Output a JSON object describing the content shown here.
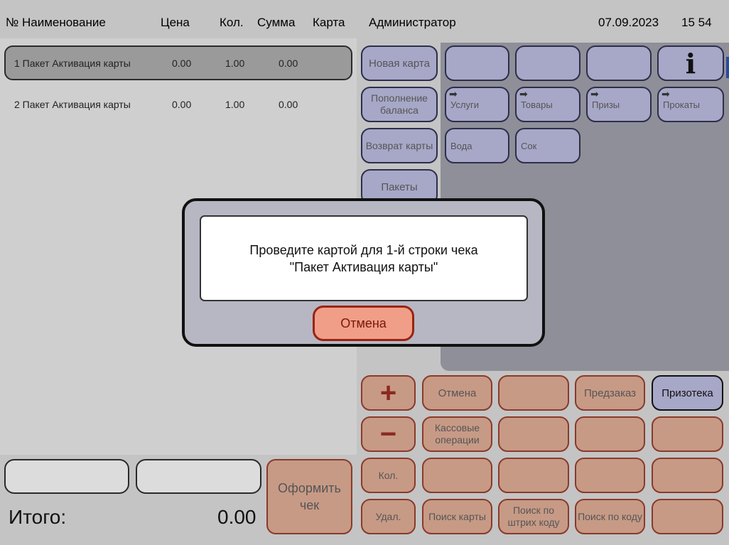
{
  "header": {
    "num_name": "№ Наименование",
    "price": "Цена",
    "qty": "Кол.",
    "sum": "Сумма",
    "card": "Карта",
    "user": "Администратор",
    "date": "07.09.2023",
    "time": "15 54"
  },
  "receipt_rows": [
    {
      "name": "1 Пакет Активация карты",
      "price": "0.00",
      "qty": "1.00",
      "sum": "0.00"
    },
    {
      "name": "2 Пакет Активация карты",
      "price": "0.00",
      "qty": "1.00",
      "sum": "0.00"
    }
  ],
  "actions": {
    "new_card": "Новая карта",
    "top_up": "Пополнение баланса",
    "return_card": "Возврат карты",
    "packages": "Пакеты"
  },
  "categories": {
    "services": "Услуги",
    "goods": "Товары",
    "prizes": "Призы",
    "rentals": "Прокаты",
    "water": "Вода",
    "juice": "Сок"
  },
  "keypad": {
    "cancel": "Отмена",
    "preorder": "Предзаказ",
    "prize_shop": "Призотека",
    "cash_ops": "Кассовые операции",
    "qty": "Кол.",
    "delete": "Удал.",
    "search_card": "Поиск карты",
    "search_barcode": "Поиск по штрих коду",
    "search_code": "Поиск по коду"
  },
  "footer": {
    "total_label": "Итого:",
    "total_value": "0.00",
    "checkout": "Оформить чек"
  },
  "dialog": {
    "line1": "Проведите картой для 1-й строки чека",
    "line2": "\"Пакет Активация карты\"",
    "cancel": "Отмена"
  },
  "colors": {
    "panel": "#c4c4c4",
    "purple_button": "#a7a7c8",
    "orange_button": "#c79a86",
    "dialog_cancel": "#f19e89"
  }
}
